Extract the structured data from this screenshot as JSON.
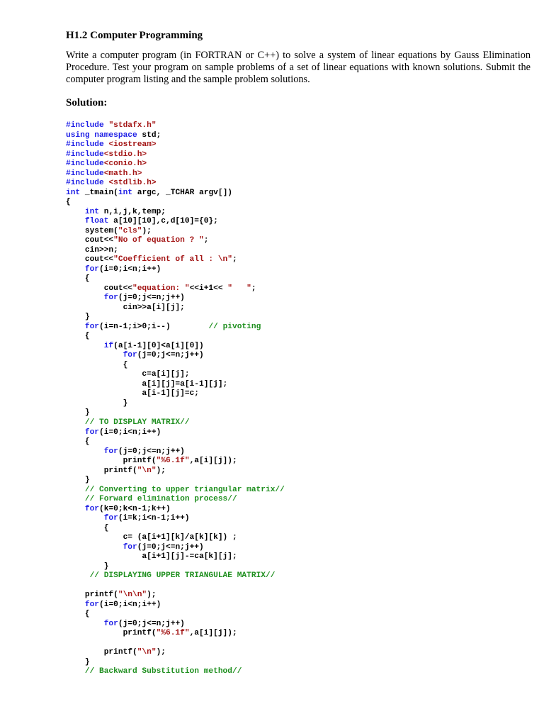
{
  "heading": "H1.2 Computer Programming",
  "paragraph": "Write a computer program (in FORTRAN or C++) to solve a system of linear equations by Gauss Elimination Procedure. Test your program on sample problems of a set of linear equations with known solutions. Submit the computer program listing and the sample problem solutions.",
  "solution_label": "Solution:",
  "colors": {
    "keyword": "#1f1fe6",
    "string": "#a31515",
    "comment": "#1f8f1f"
  },
  "code": [
    [
      [
        "k",
        "#include"
      ],
      [
        "t",
        " "
      ],
      [
        "s",
        "\"stdafx.h\""
      ]
    ],
    [
      [
        "k",
        "using namespace"
      ],
      [
        "t",
        " std;"
      ]
    ],
    [
      [
        "k",
        "#include"
      ],
      [
        "t",
        " "
      ],
      [
        "s",
        "<iostream>"
      ]
    ],
    [
      [
        "k",
        "#include"
      ],
      [
        "s",
        "<stdio.h>"
      ]
    ],
    [
      [
        "k",
        "#include"
      ],
      [
        "s",
        "<conio.h>"
      ]
    ],
    [
      [
        "k",
        "#include"
      ],
      [
        "s",
        "<math.h>"
      ]
    ],
    [
      [
        "k",
        "#include"
      ],
      [
        "t",
        " "
      ],
      [
        "s",
        "<stdlib.h>"
      ]
    ],
    [
      [
        "k",
        "int"
      ],
      [
        "t",
        " _tmain("
      ],
      [
        "k",
        "int"
      ],
      [
        "t",
        " argc, _TCHAR argv[])"
      ]
    ],
    [
      [
        "t",
        "{"
      ]
    ],
    [
      [
        "t",
        "    "
      ],
      [
        "k",
        "int"
      ],
      [
        "t",
        " n,i,j,k,temp;"
      ]
    ],
    [
      [
        "t",
        "    "
      ],
      [
        "k",
        "float"
      ],
      [
        "t",
        " a[10][10],c,d[10]={0};"
      ]
    ],
    [
      [
        "t",
        "    system("
      ],
      [
        "s",
        "\"cls\""
      ],
      [
        "t",
        ");"
      ]
    ],
    [
      [
        "t",
        "    cout<<"
      ],
      [
        "s",
        "\"No of equation ? \""
      ],
      [
        "t",
        ";"
      ]
    ],
    [
      [
        "t",
        "    cin>>n;"
      ]
    ],
    [
      [
        "t",
        "    cout<<"
      ],
      [
        "s",
        "\"Coefficient of all : \\n\""
      ],
      [
        "t",
        ";"
      ]
    ],
    [
      [
        "t",
        "    "
      ],
      [
        "k",
        "for"
      ],
      [
        "t",
        "(i=0;i<n;i++)"
      ]
    ],
    [
      [
        "t",
        "    {"
      ]
    ],
    [
      [
        "t",
        "        cout<<"
      ],
      [
        "s",
        "\"equation: \""
      ],
      [
        "t",
        "<<i+1<< "
      ],
      [
        "s",
        "\"   \""
      ],
      [
        "t",
        ";"
      ]
    ],
    [
      [
        "t",
        "        "
      ],
      [
        "k",
        "for"
      ],
      [
        "t",
        "(j=0;j<=n;j++)"
      ]
    ],
    [
      [
        "t",
        "            cin>>a[i][j];"
      ]
    ],
    [
      [
        "t",
        "    }"
      ]
    ],
    [
      [
        "t",
        "    "
      ],
      [
        "k",
        "for"
      ],
      [
        "t",
        "(i=n-1;i>0;i--)        "
      ],
      [
        "c",
        "// pivoting"
      ]
    ],
    [
      [
        "t",
        "    {"
      ]
    ],
    [
      [
        "t",
        "        "
      ],
      [
        "k",
        "if"
      ],
      [
        "t",
        "(a[i-1][0]<a[i][0])"
      ]
    ],
    [
      [
        "t",
        "            "
      ],
      [
        "k",
        "for"
      ],
      [
        "t",
        "(j=0;j<=n;j++)"
      ]
    ],
    [
      [
        "t",
        "            {"
      ]
    ],
    [
      [
        "t",
        "                c=a[i][j];"
      ]
    ],
    [
      [
        "t",
        "                a[i][j]=a[i-1][j];"
      ]
    ],
    [
      [
        "t",
        "                a[i-1][j]=c;"
      ]
    ],
    [
      [
        "t",
        "            }"
      ]
    ],
    [
      [
        "t",
        "    }"
      ]
    ],
    [
      [
        "t",
        "    "
      ],
      [
        "c",
        "// TO DISPLAY MATRIX//"
      ]
    ],
    [
      [
        "t",
        "    "
      ],
      [
        "k",
        "for"
      ],
      [
        "t",
        "(i=0;i<n;i++)"
      ]
    ],
    [
      [
        "t",
        "    {"
      ]
    ],
    [
      [
        "t",
        "        "
      ],
      [
        "k",
        "for"
      ],
      [
        "t",
        "(j=0;j<=n;j++)"
      ]
    ],
    [
      [
        "t",
        "            printf("
      ],
      [
        "s",
        "\"%6.1f\""
      ],
      [
        "t",
        ",a[i][j]);"
      ]
    ],
    [
      [
        "t",
        "        printf("
      ],
      [
        "s",
        "\"\\n\""
      ],
      [
        "t",
        ");"
      ]
    ],
    [
      [
        "t",
        "    }"
      ]
    ],
    [
      [
        "t",
        "    "
      ],
      [
        "c",
        "// Converting to upper triangular matrix//"
      ]
    ],
    [
      [
        "t",
        "    "
      ],
      [
        "c",
        "// Forward elimination process//"
      ]
    ],
    [
      [
        "t",
        "    "
      ],
      [
        "k",
        "for"
      ],
      [
        "t",
        "(k=0;k<n-1;k++)"
      ]
    ],
    [
      [
        "t",
        "        "
      ],
      [
        "k",
        "for"
      ],
      [
        "t",
        "(i=k;i<n-1;i++)"
      ]
    ],
    [
      [
        "t",
        "        {"
      ]
    ],
    [
      [
        "t",
        "            c= (a[i+1][k]/a[k][k]) ;"
      ]
    ],
    [
      [
        "t",
        "            "
      ],
      [
        "k",
        "for"
      ],
      [
        "t",
        "(j=0;j<=n;j++)"
      ]
    ],
    [
      [
        "t",
        "                a[i+1][j]-=ca[k][j];"
      ]
    ],
    [
      [
        "t",
        "        }"
      ]
    ],
    [
      [
        "t",
        "     "
      ],
      [
        "c",
        "// DISPLAYING UPPER TRIANGULAE MATRIX//"
      ]
    ],
    [
      [
        "t",
        ""
      ]
    ],
    [
      [
        "t",
        "    printf("
      ],
      [
        "s",
        "\"\\n\\n\""
      ],
      [
        "t",
        ");"
      ]
    ],
    [
      [
        "t",
        "    "
      ],
      [
        "k",
        "for"
      ],
      [
        "t",
        "(i=0;i<n;i++)"
      ]
    ],
    [
      [
        "t",
        "    {"
      ]
    ],
    [
      [
        "t",
        "        "
      ],
      [
        "k",
        "for"
      ],
      [
        "t",
        "(j=0;j<=n;j++)"
      ]
    ],
    [
      [
        "t",
        "            printf("
      ],
      [
        "s",
        "\"%6.1f\""
      ],
      [
        "t",
        ",a[i][j]);"
      ]
    ],
    [
      [
        "t",
        ""
      ]
    ],
    [
      [
        "t",
        "        printf("
      ],
      [
        "s",
        "\"\\n\""
      ],
      [
        "t",
        ");"
      ]
    ],
    [
      [
        "t",
        "    }"
      ]
    ],
    [
      [
        "t",
        "    "
      ],
      [
        "c",
        "// Backward Substitution method//"
      ]
    ]
  ]
}
